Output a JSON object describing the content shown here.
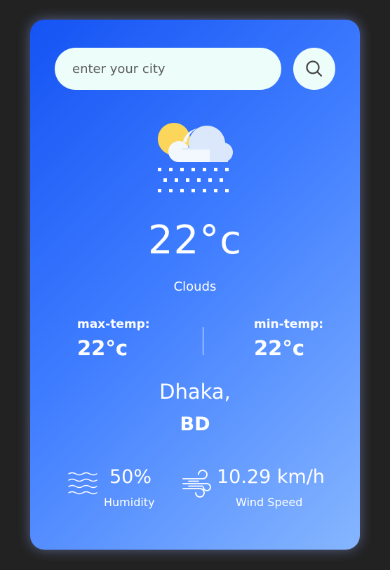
{
  "search": {
    "placeholder": "enter your city",
    "value": ""
  },
  "weather": {
    "icon": "cloud-sun-snow-icon",
    "temperature": "22°c",
    "condition": "Clouds"
  },
  "max_temp": {
    "label": "max-temp:",
    "value": "22°c"
  },
  "min_temp": {
    "label": "min-temp:",
    "value": "22°c"
  },
  "location": {
    "city": "Dhaka,",
    "country": "BD"
  },
  "humidity": {
    "icon": "waves-icon",
    "value": "50%",
    "label": "Humidity"
  },
  "wind": {
    "icon": "wind-icon",
    "value": "10.29 km/h",
    "label": "Wind Speed"
  },
  "colors": {
    "background": "#222222",
    "card_gradient_start": "#1553f4",
    "card_gradient_end": "#86b6ff",
    "input_bg": "#edfdf9",
    "sun": "#fcd65a",
    "cloud_light": "#f3f8ff",
    "cloud_shade": "#dbe8fb"
  }
}
